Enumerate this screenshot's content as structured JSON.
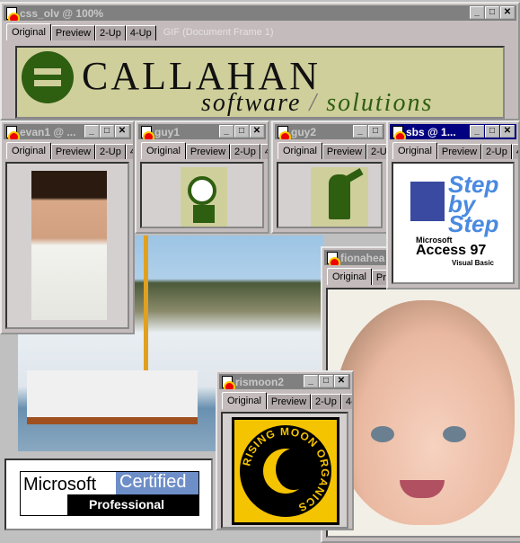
{
  "tabs": [
    "Original",
    "Preview",
    "2-Up",
    "4-Up"
  ],
  "controls": {
    "minimize": "_",
    "maximize": "□",
    "close": "✕"
  },
  "main": {
    "title": "css_olv @  100%",
    "info": "GIF (Document Frame 1)",
    "logo": {
      "name": "CALLAHAN",
      "tagline1": "software",
      "tagline2": "solutions"
    }
  },
  "windows": {
    "evan1": {
      "title": "evan1 @ ..."
    },
    "guy1": {
      "title": "guy1"
    },
    "guy2": {
      "title": "guy2"
    },
    "sbs": {
      "title": "sbs @  1...",
      "book": {
        "line1": "Step",
        "line2": "by",
        "line3": "Step",
        "brand": "Microsoft",
        "product": "Access 97",
        "sub": "Visual Basic"
      }
    },
    "fionahead": {
      "title": "fionahea"
    },
    "rismoon2": {
      "title": "rismoon2",
      "logo": "RISING MOON ORGANICS"
    }
  },
  "mcp": {
    "brand": "Microsoft",
    "cert": "Certified",
    "level": "Professional"
  },
  "colors": {
    "active_title": "#000080",
    "inactive_title": "#808080",
    "logo_bg": "#cfcf9c",
    "logo_green": "#2e5e10",
    "rising_yellow": "#f5c400"
  }
}
